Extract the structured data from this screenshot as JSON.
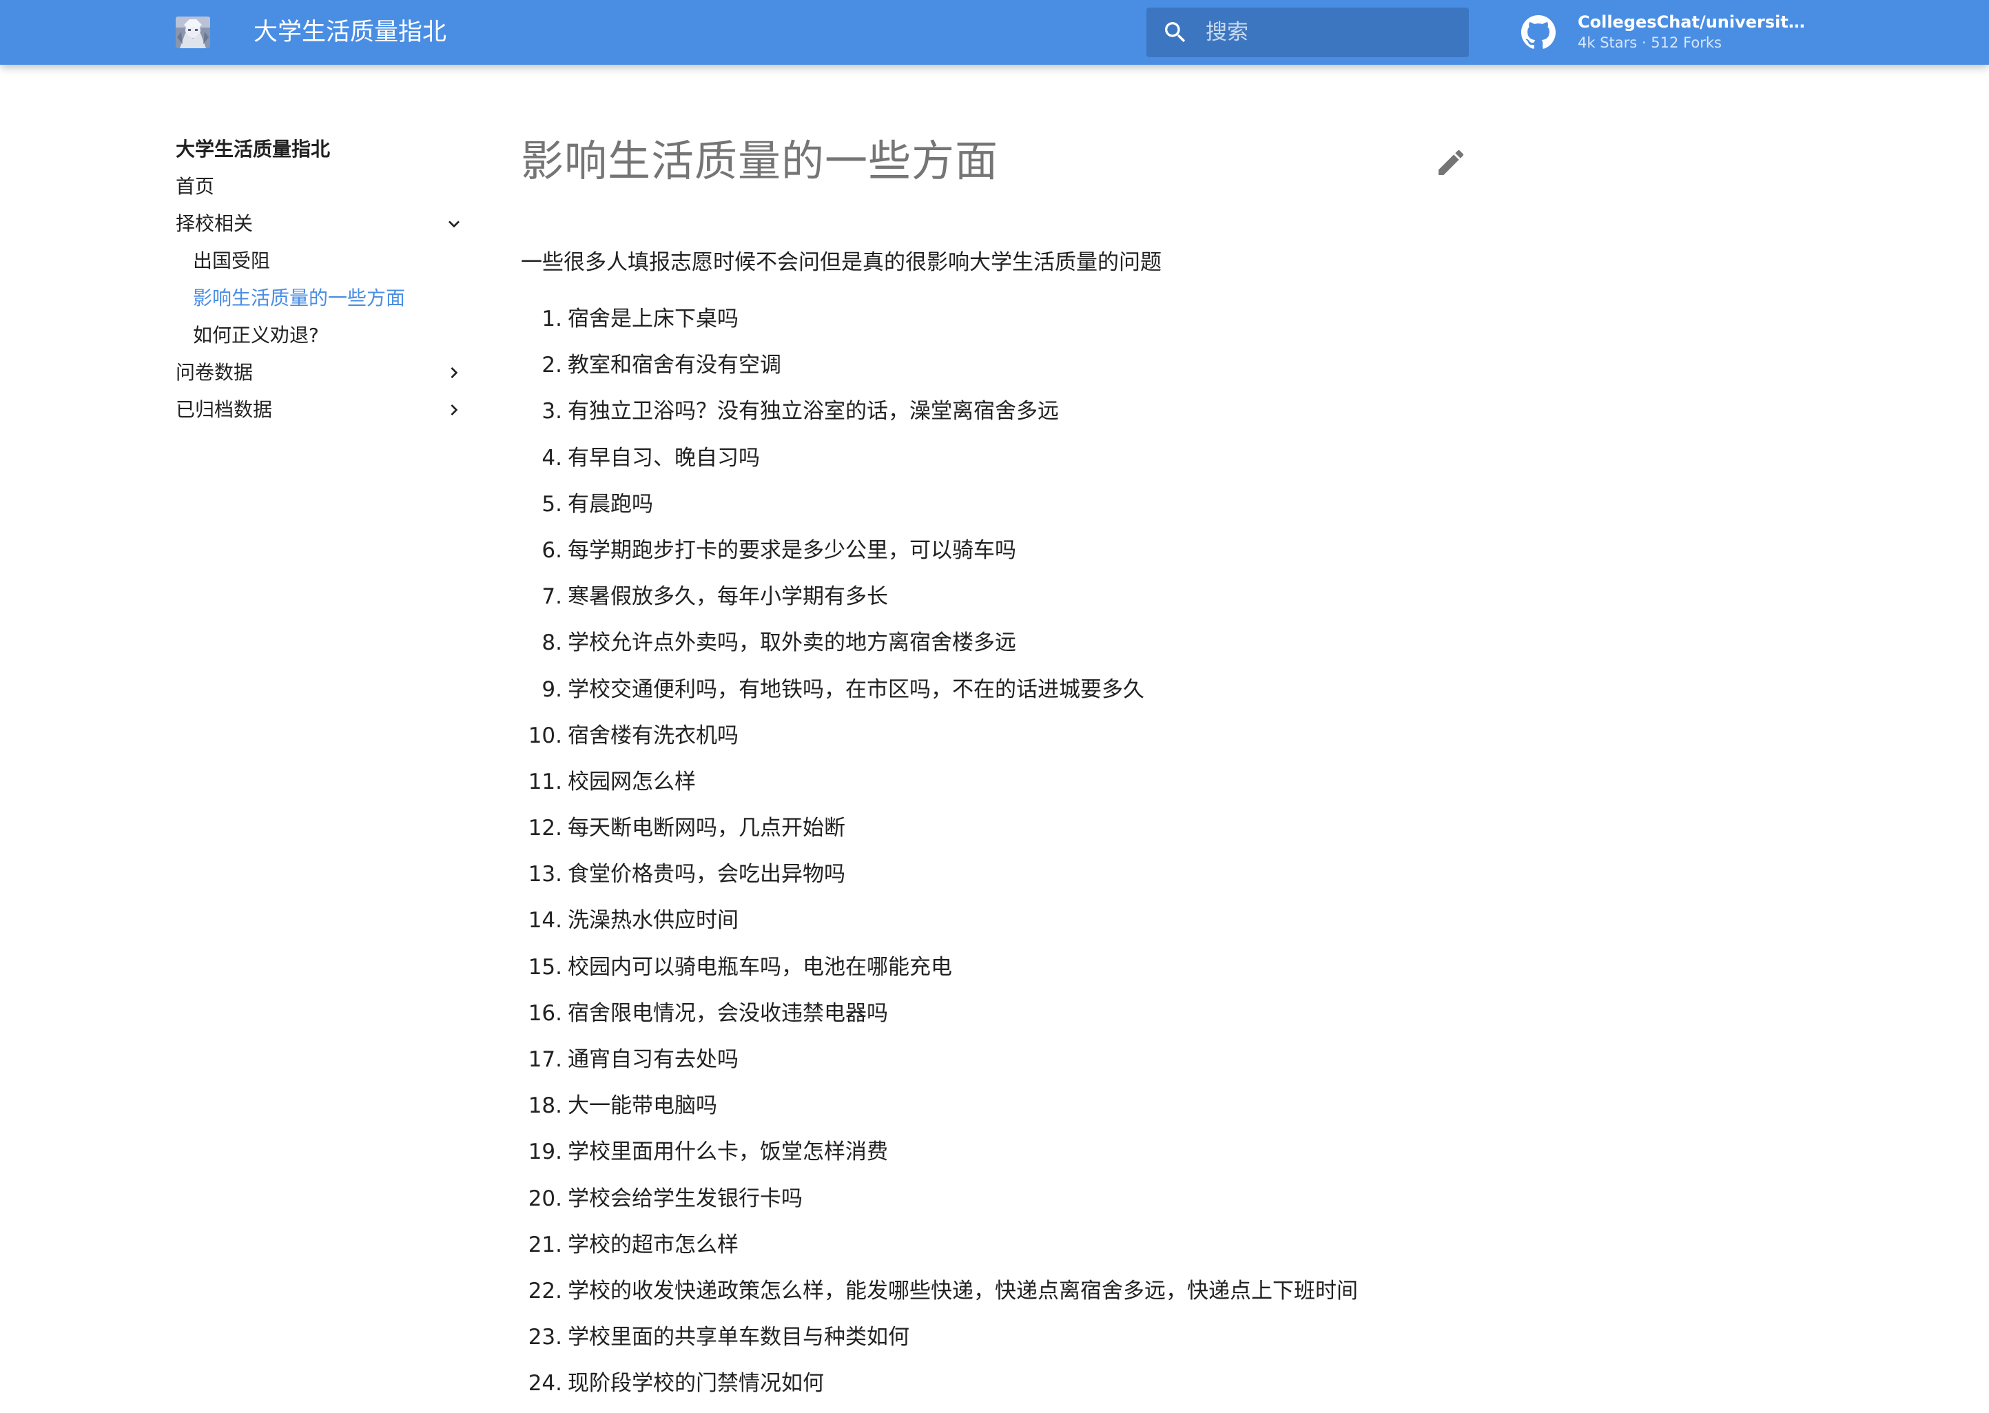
{
  "header": {
    "site_title": "大学生活质量指北",
    "search_placeholder": "搜索",
    "repo": {
      "name": "CollegesChat/university-in...",
      "stars": "4k Stars",
      "separator": "·",
      "forks": "512 Forks"
    }
  },
  "sidebar": {
    "title": "大学生活质量指北",
    "items": [
      {
        "label": "首页"
      },
      {
        "label": "择校相关",
        "expanded": true,
        "chevron": "chevron-down-icon"
      },
      {
        "label": "出国受阻"
      },
      {
        "label": "影响生活质量的一些方面",
        "active": true
      },
      {
        "label": "如何正义劝退?"
      },
      {
        "label": "问卷数据",
        "chevron": "chevron-right-icon"
      },
      {
        "label": "已归档数据",
        "chevron": "chevron-right-icon"
      }
    ]
  },
  "main": {
    "title": "影响生活质量的一些方面",
    "intro": "一些很多人填报志愿时候不会问但是真的很影响大学生活质量的问题",
    "questions": [
      {
        "num": "1.",
        "text": "宿舍是上床下桌吗"
      },
      {
        "num": "2.",
        "text": "教室和宿舍有没有空调"
      },
      {
        "num": "3.",
        "text": "有独立卫浴吗？没有独立浴室的话，澡堂离宿舍多远"
      },
      {
        "num": "4.",
        "text": "有早自习、晚自习吗"
      },
      {
        "num": "5.",
        "text": "有晨跑吗"
      },
      {
        "num": "6.",
        "text": "每学期跑步打卡的要求是多少公里，可以骑车吗"
      },
      {
        "num": "7.",
        "text": "寒暑假放多久，每年小学期有多长"
      },
      {
        "num": "8.",
        "text": "学校允许点外卖吗，取外卖的地方离宿舍楼多远"
      },
      {
        "num": "9.",
        "text": "学校交通便利吗，有地铁吗，在市区吗，不在的话进城要多久"
      },
      {
        "num": "10.",
        "text": "宿舍楼有洗衣机吗"
      },
      {
        "num": "11.",
        "text": "校园网怎么样"
      },
      {
        "num": "12.",
        "text": "每天断电断网吗，几点开始断"
      },
      {
        "num": "13.",
        "text": "食堂价格贵吗，会吃出异物吗"
      },
      {
        "num": "14.",
        "text": "洗澡热水供应时间"
      },
      {
        "num": "15.",
        "text": "校园内可以骑电瓶车吗，电池在哪能充电"
      },
      {
        "num": "16.",
        "text": "宿舍限电情况，会没收违禁电器吗"
      },
      {
        "num": "17.",
        "text": "通宵自习有去处吗"
      },
      {
        "num": "18.",
        "text": "大一能带电脑吗"
      },
      {
        "num": "19.",
        "text": "学校里面用什么卡，饭堂怎样消费"
      },
      {
        "num": "20.",
        "text": "学校会给学生发银行卡吗"
      },
      {
        "num": "21.",
        "text": "学校的超市怎么样"
      },
      {
        "num": "22.",
        "text": "学校的收发快递政策怎么样，能发哪些快递，快递点离宿舍多远，快递点上下班时间"
      },
      {
        "num": "23.",
        "text": "学校里面的共享单车数目与种类如何"
      },
      {
        "num": "24.",
        "text": "现阶段学校的门禁情况如何"
      }
    ]
  },
  "colors": {
    "primary": "#4a8ee4",
    "search_bg": "#3d76c0",
    "active_link": "#4a8ee4"
  },
  "icons": [
    "logo",
    "search-icon",
    "github-icon",
    "chevron-down-icon",
    "chevron-right-icon",
    "edit-icon"
  ]
}
